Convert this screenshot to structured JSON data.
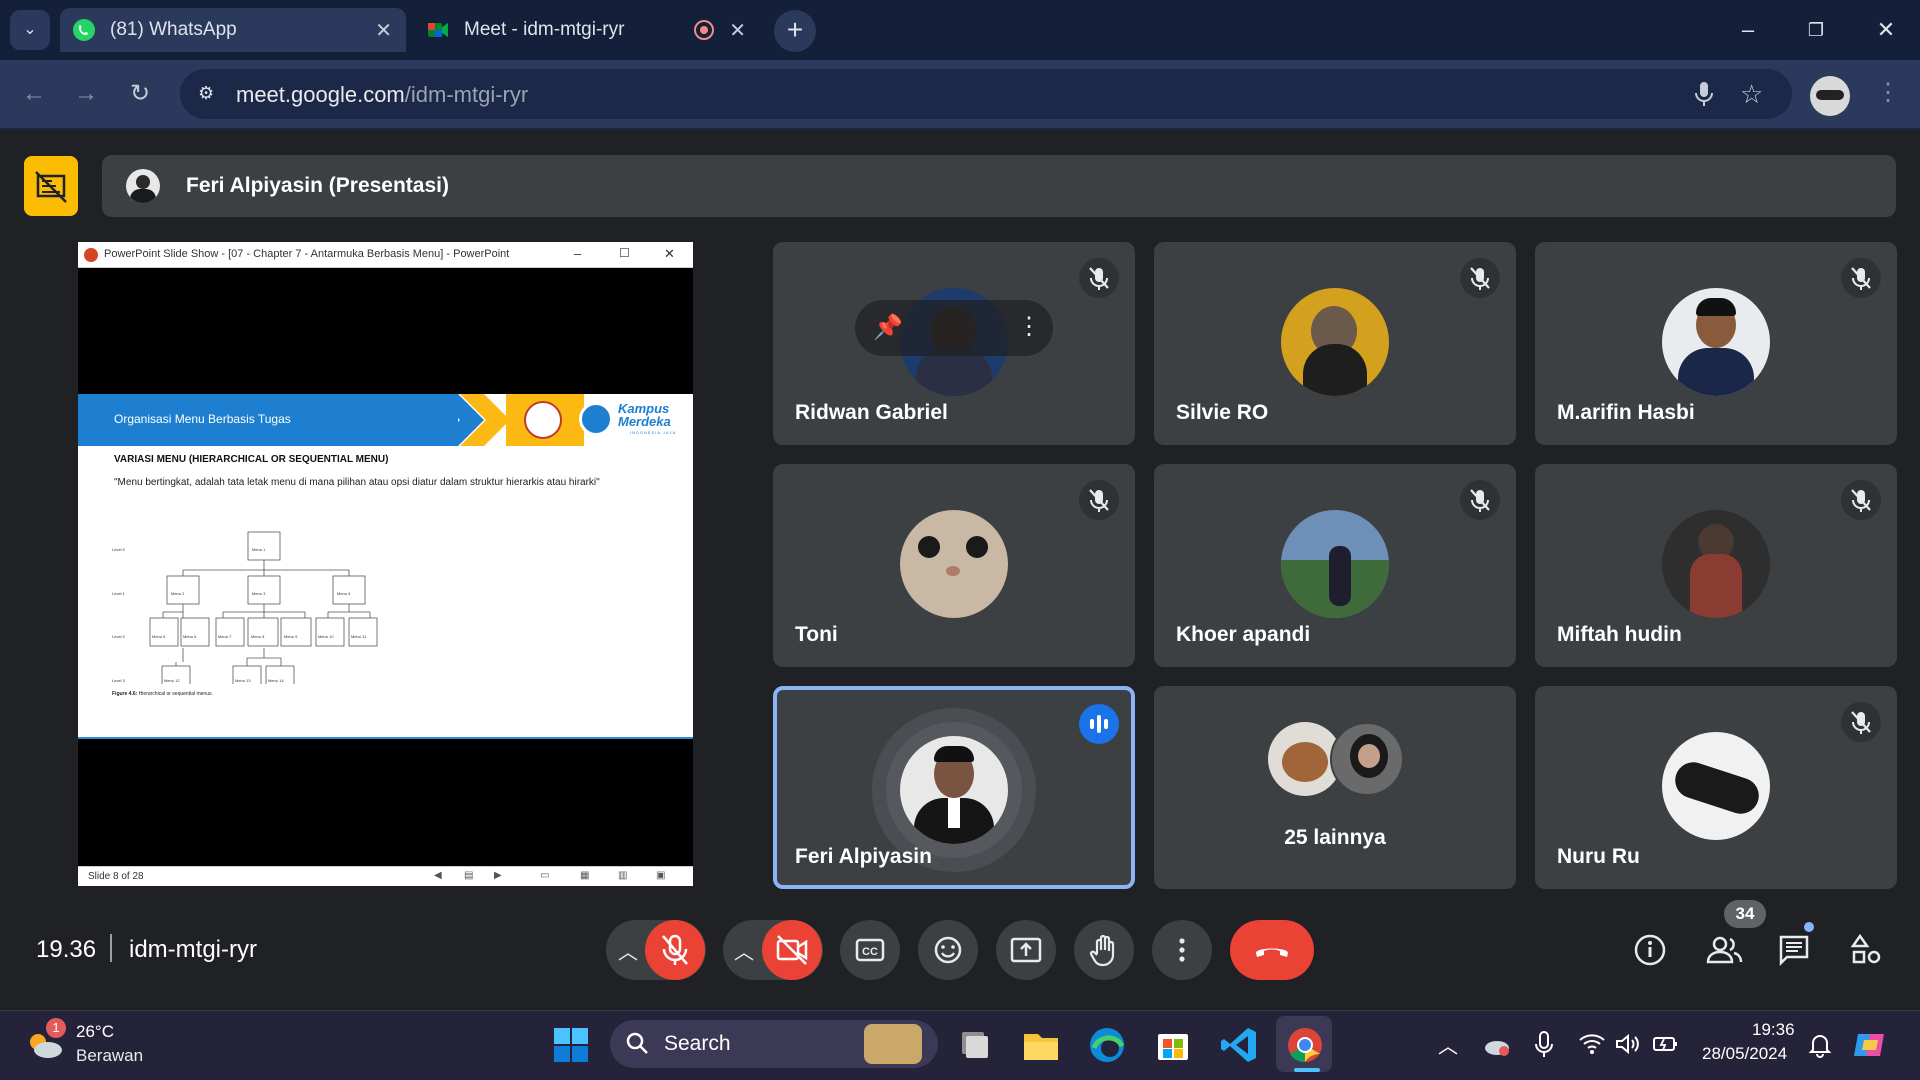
{
  "browser": {
    "tabs": [
      {
        "label": "(81) WhatsApp",
        "active": true
      },
      {
        "label": "Meet - idm-mtgi-ryr",
        "active": false
      }
    ],
    "url_host": "meet.google.com",
    "url_path": "/idm-mtgi-ryr"
  },
  "meet": {
    "presenter_label": "Feri Alpiyasin (Presentasi)",
    "time": "19.36",
    "meeting_code": "idm-mtgi-ryr",
    "people_count": "34",
    "participants": [
      {
        "name": "Ridwan Gabriel",
        "muted": true
      },
      {
        "name": "Silvie RO",
        "muted": true
      },
      {
        "name": "M.arifin Hasbi",
        "muted": true
      },
      {
        "name": "Toni",
        "muted": true
      },
      {
        "name": "Khoer apandi",
        "muted": true
      },
      {
        "name": "Miftah hudin",
        "muted": true
      },
      {
        "name": "Feri Alpiyasin",
        "muted": false,
        "speaking": true
      },
      {
        "name": "25 lainnya",
        "muted": false
      },
      {
        "name": "Nuru Ru",
        "muted": true
      }
    ],
    "colors": {
      "accent": "#8ab4f8",
      "danger": "#ea4335",
      "tile": "#3c4043",
      "present": "#fbbc04"
    }
  },
  "slide": {
    "window_title": "PowerPoint Slide Show - [07 - Chapter 7 - Antarmuka Berbasis Menu] - PowerPoint",
    "banner": "Organisasi Menu Berbasis Tugas",
    "logo_text": "Kampus Merdeka",
    "logo_sub": "INDONESIA JAYA",
    "heading": "VARIASI MENU (HIERARCHICAL OR SEQUENTIAL MENU)",
    "body": "\"Menu bertingkat, adalah tata letak menu di mana pilihan atau opsi diatur dalam struktur hierarkis atau hirarki\"",
    "levels": [
      "Level 0",
      "Level 1",
      "Level 2",
      "Level 3"
    ],
    "menus": {
      "l0": [
        "Menu 1"
      ],
      "l1": [
        "Menu 2",
        "Menu 3",
        "Menu 4"
      ],
      "l2": [
        "Menu 5",
        "Menu 6",
        "Menu 7",
        "Menu 8",
        "Menu 9",
        "Menu 10",
        "Menu 11"
      ],
      "l3": [
        "Menu 12",
        "Menu 13",
        "Menu 14"
      ]
    },
    "figure_caption_bold": "Figure 4.6:",
    "figure_caption": " Hierarchical or sequential menus.",
    "status": "Slide 8 of 28"
  },
  "taskbar": {
    "weather_temp": "26°C",
    "weather_desc": "Berawan",
    "weather_badge": "1",
    "search_placeholder": "Search",
    "clock_time": "19:36",
    "clock_date": "28/05/2024"
  }
}
